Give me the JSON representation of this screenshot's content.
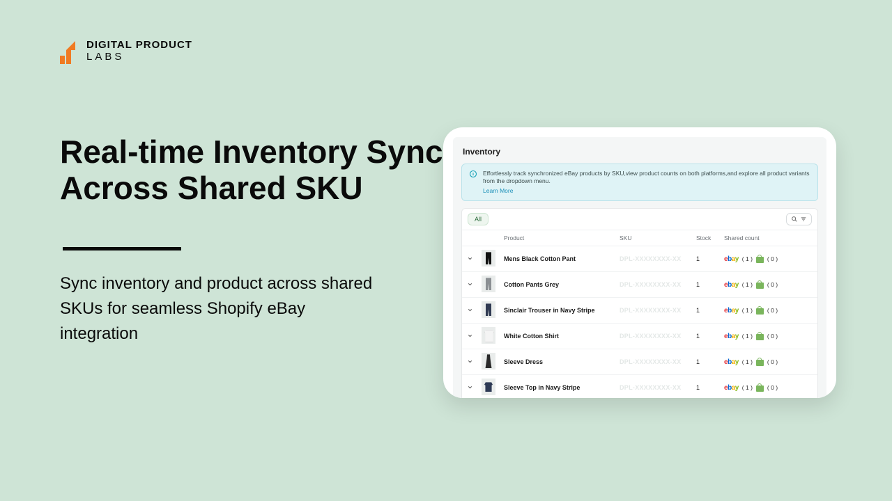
{
  "logo": {
    "line1": "DIGITAL PRODUCT",
    "line2": "LABS"
  },
  "headline": "Real-time Inventory Sync Across Shared SKU",
  "subtitle": "Sync inventory and product across shared SKUs for seamless Shopify eBay integration",
  "app": {
    "panel_title": "Inventory",
    "info_text": "Effortlessly track synchronized eBay products by SKU,view product counts on both platforms,and explore all product variants from the dropdown menu.",
    "info_link": "Learn More",
    "tab_all": "All",
    "columns": {
      "product": "Product",
      "sku": "SKU",
      "stock": "Stock",
      "shared": "Shared count"
    },
    "rows": [
      {
        "name": "Mens Black Cotton Pant",
        "thumb": "g-pant-dark",
        "sku_mask": "DPL-XXXXXXXX-XX",
        "stock": "1",
        "ebay_count": "( 1 )",
        "shop_count": "( 0 )"
      },
      {
        "name": "Cotton Pants Grey",
        "thumb": "g-pant-grey",
        "sku_mask": "DPL-XXXXXXXX-XX",
        "stock": "1",
        "ebay_count": "( 1 )",
        "shop_count": "( 0 )"
      },
      {
        "name": "Sinclair Trouser in Navy Stripe",
        "thumb": "g-trouser-navy",
        "sku_mask": "DPL-XXXXXXXX-XX",
        "stock": "1",
        "ebay_count": "( 1 )",
        "shop_count": "( 0 )"
      },
      {
        "name": "White Cotton Shirt",
        "thumb": "g-shirt-white",
        "sku_mask": "DPL-XXXXXXXX-XX",
        "stock": "1",
        "ebay_count": "( 1 )",
        "shop_count": "( 0 )"
      },
      {
        "name": "Sleeve Dress",
        "thumb": "g-dress",
        "sku_mask": "DPL-XXXXXXXX-XX",
        "stock": "1",
        "ebay_count": "( 1 )",
        "shop_count": "( 0 )"
      },
      {
        "name": "Sleeve Top in Navy Stripe",
        "thumb": "g-top-navy",
        "sku_mask": "DPL-XXXXXXXX-XX",
        "stock": "1",
        "ebay_count": "( 1 )",
        "shop_count": "( 0 )"
      }
    ]
  }
}
